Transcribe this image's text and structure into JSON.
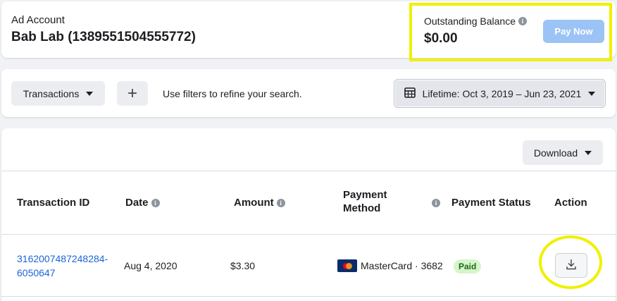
{
  "account": {
    "label": "Ad Account",
    "name": "Bab Lab (1389551504555772)"
  },
  "balance": {
    "label": "Outstanding Balance",
    "value": "$0.00",
    "pay_label": "Pay Now"
  },
  "filters": {
    "type_label": "Transactions",
    "add_label": "+",
    "hint": "Use filters to refine your search.",
    "date_range": "Lifetime: Oct 3, 2019 – Jun 23, 2021"
  },
  "table": {
    "download_label": "Download",
    "headers": {
      "id": "Transaction ID",
      "date": "Date",
      "amount": "Amount",
      "method_line1": "Payment",
      "method_line2": "Method",
      "status": "Payment Status",
      "action": "Action"
    },
    "rows": [
      {
        "id_line1": "3162007487248284-",
        "id_line2": "6050647",
        "date": "Aug 4, 2020",
        "amount": "$3.30",
        "method": "MasterCard · 3682",
        "status": "Paid"
      }
    ]
  },
  "colors": {
    "accent": "#1b64d6",
    "pay_button": "#9cc3f5",
    "highlight": "#f0f000",
    "paid_badge": "#d6f5c8"
  }
}
